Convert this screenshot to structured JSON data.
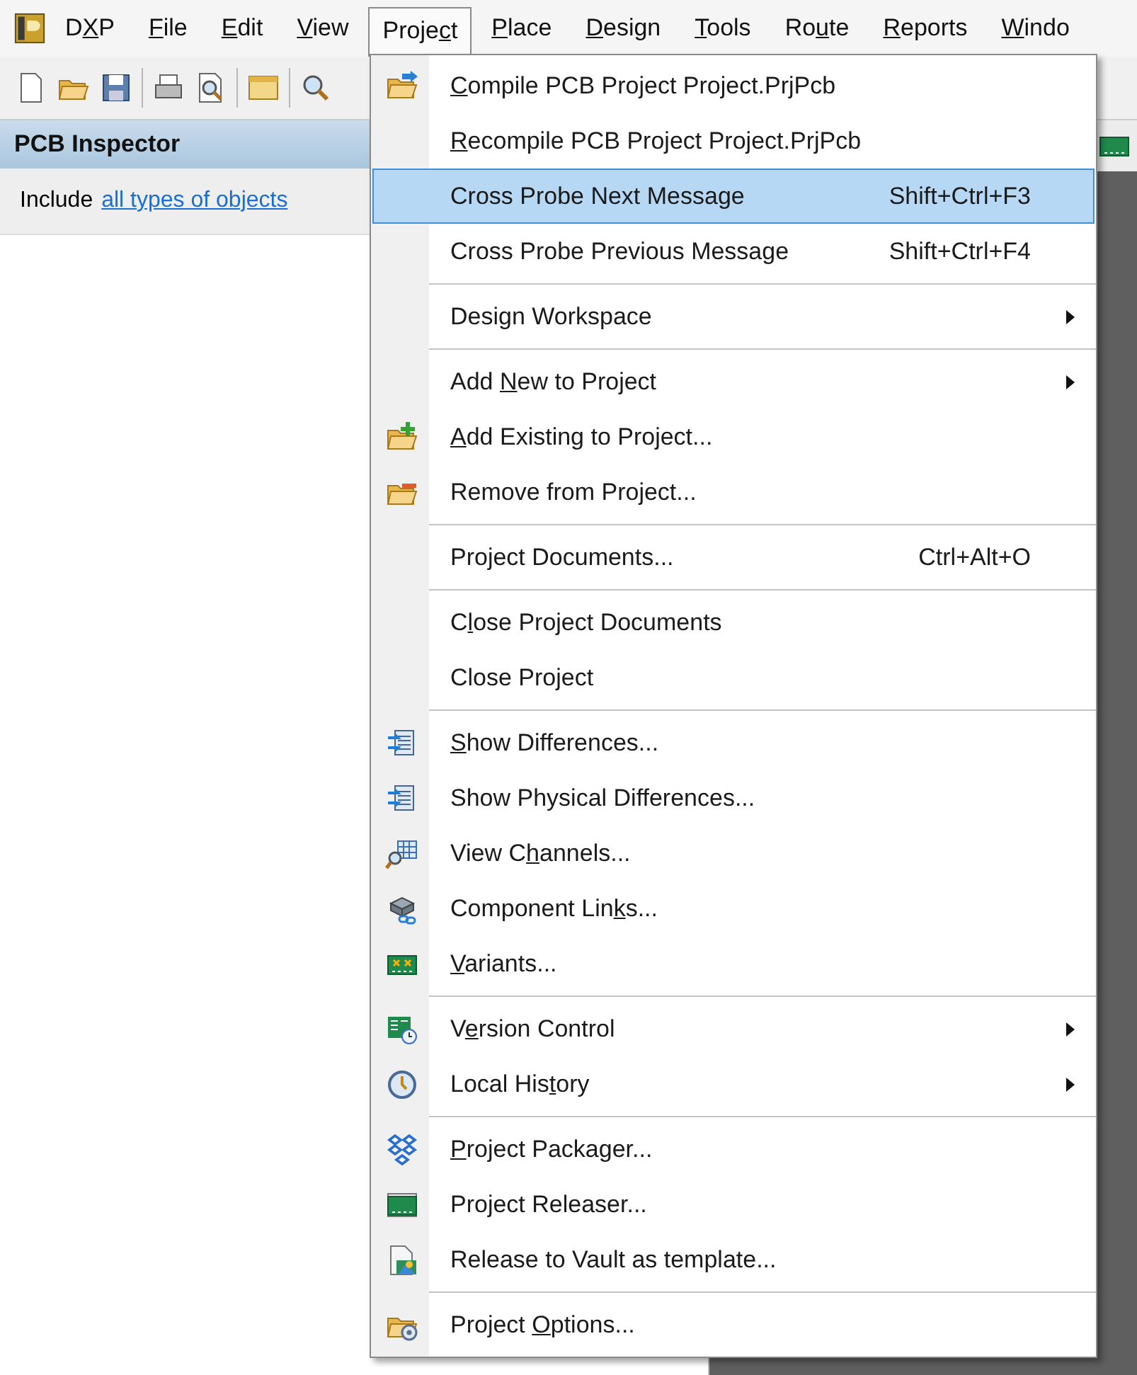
{
  "menu_bar": [
    {
      "before": "D",
      "key": "X",
      "after": "P",
      "selected": false
    },
    {
      "key": "F",
      "after": "ile",
      "selected": false
    },
    {
      "key": "E",
      "after": "dit",
      "selected": false
    },
    {
      "key": "V",
      "after": "iew",
      "selected": false
    },
    {
      "before": "Proje",
      "key": "c",
      "after": "t",
      "selected": true
    },
    {
      "key": "P",
      "after": "lace",
      "selected": false
    },
    {
      "key": "D",
      "after": "esign",
      "selected": false
    },
    {
      "key": "T",
      "after": "ools",
      "selected": false
    },
    {
      "before": "Ro",
      "key": "u",
      "after": "te",
      "selected": false
    },
    {
      "key": "R",
      "after": "eports",
      "selected": false
    },
    {
      "key": "W",
      "after": "indo",
      "selected": false
    }
  ],
  "panel": {
    "title": "PCB Inspector",
    "include_label": "Include",
    "include_link": "all types of objects"
  },
  "menu": [
    {
      "kind": "item",
      "key": "C",
      "after": "ompile PCB Project Project.PrjPcb",
      "selected": false
    },
    {
      "kind": "item",
      "key": "R",
      "after": "ecompile PCB Project Project.PrjPcb",
      "selected": false
    },
    {
      "kind": "item",
      "before": "Cross Probe Next Message",
      "shortcut": "Shift+Ctrl+F3",
      "selected": true
    },
    {
      "kind": "item",
      "before": "Cross Probe Previous Message",
      "shortcut": "Shift+Ctrl+F4",
      "selected": false
    },
    {
      "kind": "separator"
    },
    {
      "kind": "item",
      "before": "Design Workspace",
      "submenu": true,
      "selected": false
    },
    {
      "kind": "separator"
    },
    {
      "kind": "item",
      "before": "Add ",
      "key": "N",
      "after": "ew to Project",
      "submenu": true,
      "selected": false
    },
    {
      "kind": "item",
      "key": "A",
      "after": "dd Existing to Project...",
      "selected": false
    },
    {
      "kind": "item",
      "before": "Remove from Project...",
      "selected": false
    },
    {
      "kind": "separator"
    },
    {
      "kind": "item",
      "before": "Project Documents...",
      "shortcut": "Ctrl+Alt+O",
      "selected": false
    },
    {
      "kind": "separator"
    },
    {
      "kind": "item",
      "before": "C",
      "key": "l",
      "after": "ose Project Documents",
      "selected": false
    },
    {
      "kind": "item",
      "before": "Close Project",
      "selected": false
    },
    {
      "kind": "separator"
    },
    {
      "kind": "item",
      "key": "S",
      "after": "how Differences...",
      "selected": false
    },
    {
      "kind": "item",
      "before": "Show Physical Differences...",
      "selected": false
    },
    {
      "kind": "item",
      "before": "View C",
      "key": "h",
      "after": "annels...",
      "selected": false
    },
    {
      "kind": "item",
      "before": "Component Lin",
      "key": "k",
      "after": "s...",
      "selected": false
    },
    {
      "kind": "item",
      "key": "V",
      "after": "ariants...",
      "selected": false
    },
    {
      "kind": "separator"
    },
    {
      "kind": "item",
      "before": "V",
      "key": "e",
      "after": "rsion Control",
      "submenu": true,
      "selected": false
    },
    {
      "kind": "item",
      "before": "Local His",
      "key": "t",
      "after": "ory",
      "submenu": true,
      "selected": false
    },
    {
      "kind": "separator"
    },
    {
      "kind": "item",
      "key": "P",
      "after": "roject Packager...",
      "selected": false
    },
    {
      "kind": "item",
      "before": "Project Releaser...",
      "selected": false
    },
    {
      "kind": "item",
      "before": "Release to Vault as template...",
      "selected": false
    },
    {
      "kind": "separator"
    },
    {
      "kind": "item",
      "before": "Project ",
      "key": "O",
      "after": "ptions...",
      "selected": false
    }
  ]
}
